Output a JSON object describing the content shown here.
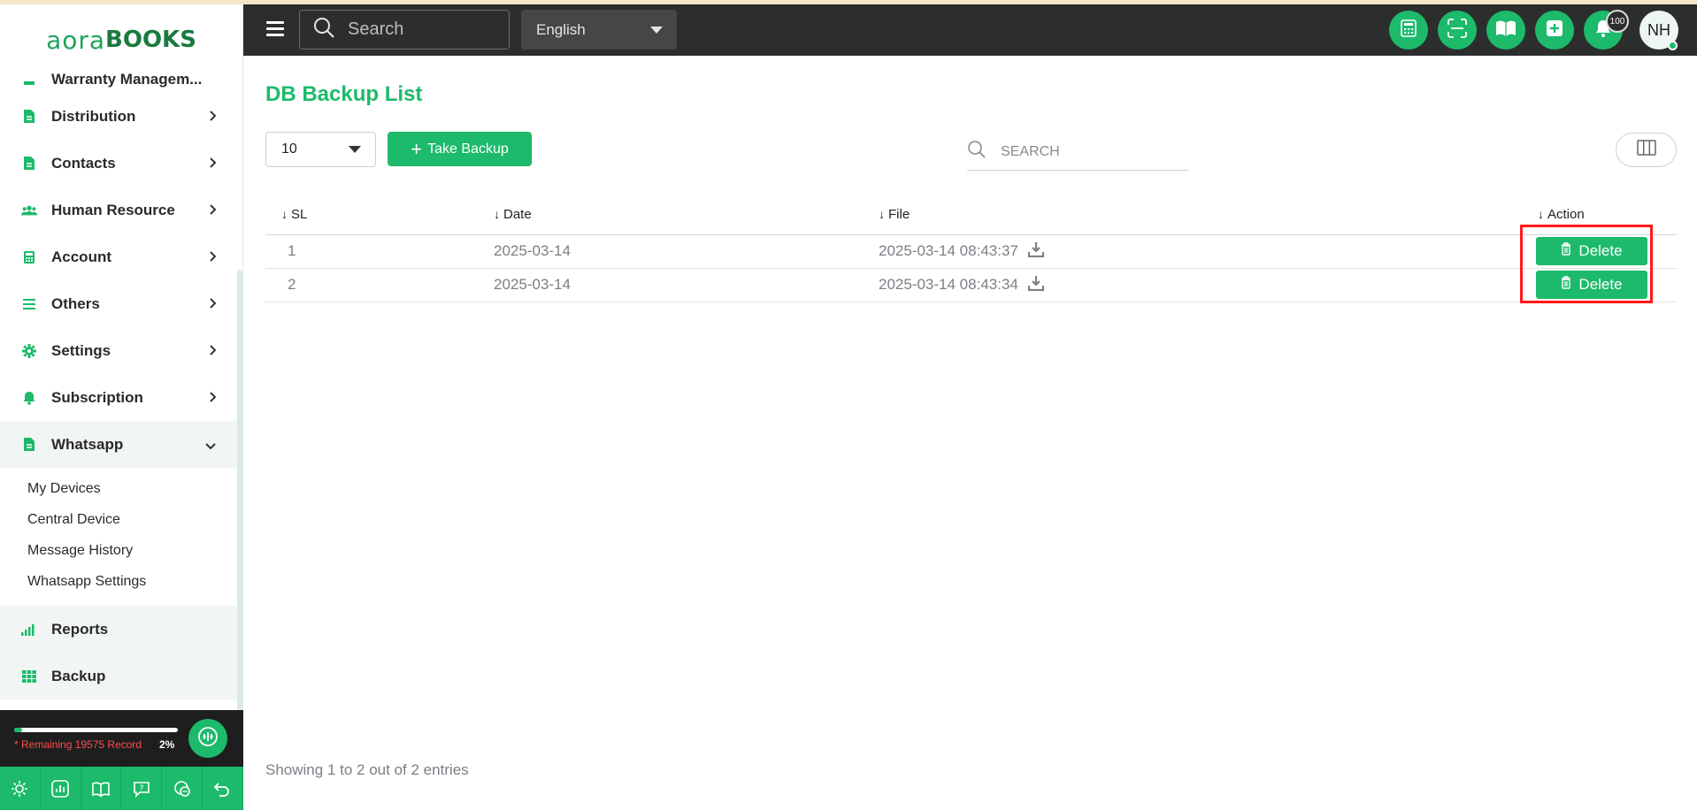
{
  "app": {
    "logo_part1": "aora",
    "logo_part2": "BOOKS"
  },
  "sidebar": {
    "partial_item": "Warranty Managem...",
    "items": [
      {
        "label": "Distribution",
        "icon": "document-icon"
      },
      {
        "label": "Contacts",
        "icon": "document-icon"
      },
      {
        "label": "Human Resource",
        "icon": "users-icon"
      },
      {
        "label": "Account",
        "icon": "calculator-icon"
      },
      {
        "label": "Others",
        "icon": "list-icon"
      },
      {
        "label": "Settings",
        "icon": "gear-icon"
      },
      {
        "label": "Subscription",
        "icon": "bell-icon"
      }
    ],
    "open_item": {
      "label": "Whatsapp",
      "icon": "document-icon"
    },
    "submenu": [
      "My Devices",
      "Central Device",
      "Message History",
      "Whatsapp Settings"
    ],
    "after_items": [
      {
        "label": "Reports",
        "icon": "bar-signal-icon"
      },
      {
        "label": "Backup",
        "icon": "grid-icon"
      }
    ],
    "footer": {
      "remaining_text": "* Remaining 19575 Record",
      "percent_label": "2%",
      "progress_fraction": 0.02
    }
  },
  "topbar": {
    "search_placeholder": "Search",
    "language": "English",
    "notification_count": "100",
    "avatar_initials": "NH"
  },
  "main": {
    "title": "DB Backup List",
    "per_page": "10",
    "take_backup_label": "Take Backup",
    "search_placeholder": "SEARCH",
    "columns": [
      "SL",
      "Date",
      "File",
      "Action"
    ],
    "rows": [
      {
        "sl": "1",
        "date": "2025-03-14",
        "file": "2025-03-14 08:43:37",
        "action": "Delete"
      },
      {
        "sl": "2",
        "date": "2025-03-14",
        "file": "2025-03-14 08:43:34",
        "action": "Delete"
      }
    ],
    "showing_text": "Showing 1 to 2 out of 2 entries"
  },
  "colors": {
    "accent": "#1cba6a",
    "topbar": "#2b2e2c",
    "highlight": "#ff1a1a"
  }
}
